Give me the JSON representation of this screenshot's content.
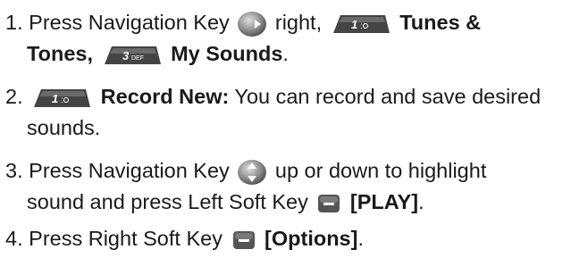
{
  "steps": [
    {
      "number": "1.",
      "line1_text1": "Press Navigation Key",
      "line1_text2": "right,",
      "key_1_label": "1",
      "line1_bold": "Tunes &",
      "line2_bold1": "Tones,",
      "key_3_label": "3",
      "key_3_sub": "DEF",
      "line2_bold2": "My Sounds",
      "line2_end": "."
    },
    {
      "number": "2.",
      "key_1_label": "1",
      "bold": "Record New:",
      "line1_text": "You can record and save desired",
      "line2_text": "sounds."
    },
    {
      "number": "3.",
      "line1_text1": "Press Navigation Key",
      "line1_text2": "up or down to highlight",
      "line2_text": "sound and press Left Soft Key",
      "line2_bold": "[PLAY]",
      "line2_end": "."
    },
    {
      "number": "4.",
      "text": "Press Right Soft Key",
      "bold": "[Options]",
      "end": "."
    }
  ]
}
